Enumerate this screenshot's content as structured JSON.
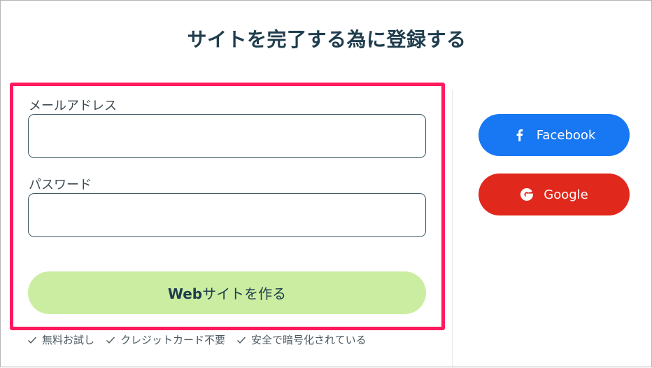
{
  "page": {
    "title": "サイトを完了する為に登録する"
  },
  "form": {
    "email_label": "メールアドレス",
    "email_value": "",
    "password_label": "パスワード",
    "password_value": "",
    "submit_brand": "Web",
    "submit_text": "サイトを作る"
  },
  "perks": [
    {
      "label": "無料お試し",
      "icon": "check-icon"
    },
    {
      "label": "クレジットカード不要",
      "icon": "check-icon"
    },
    {
      "label": "安全で暗号化されている",
      "icon": "check-icon"
    }
  ],
  "social": {
    "facebook_label": "Facebook",
    "google_label": "Google"
  },
  "colors": {
    "highlight_border": "#ff1a5e",
    "submit_bg": "#cbeda1",
    "facebook": "#1877f2",
    "google": "#e1281c",
    "title": "#1f3d4d"
  }
}
